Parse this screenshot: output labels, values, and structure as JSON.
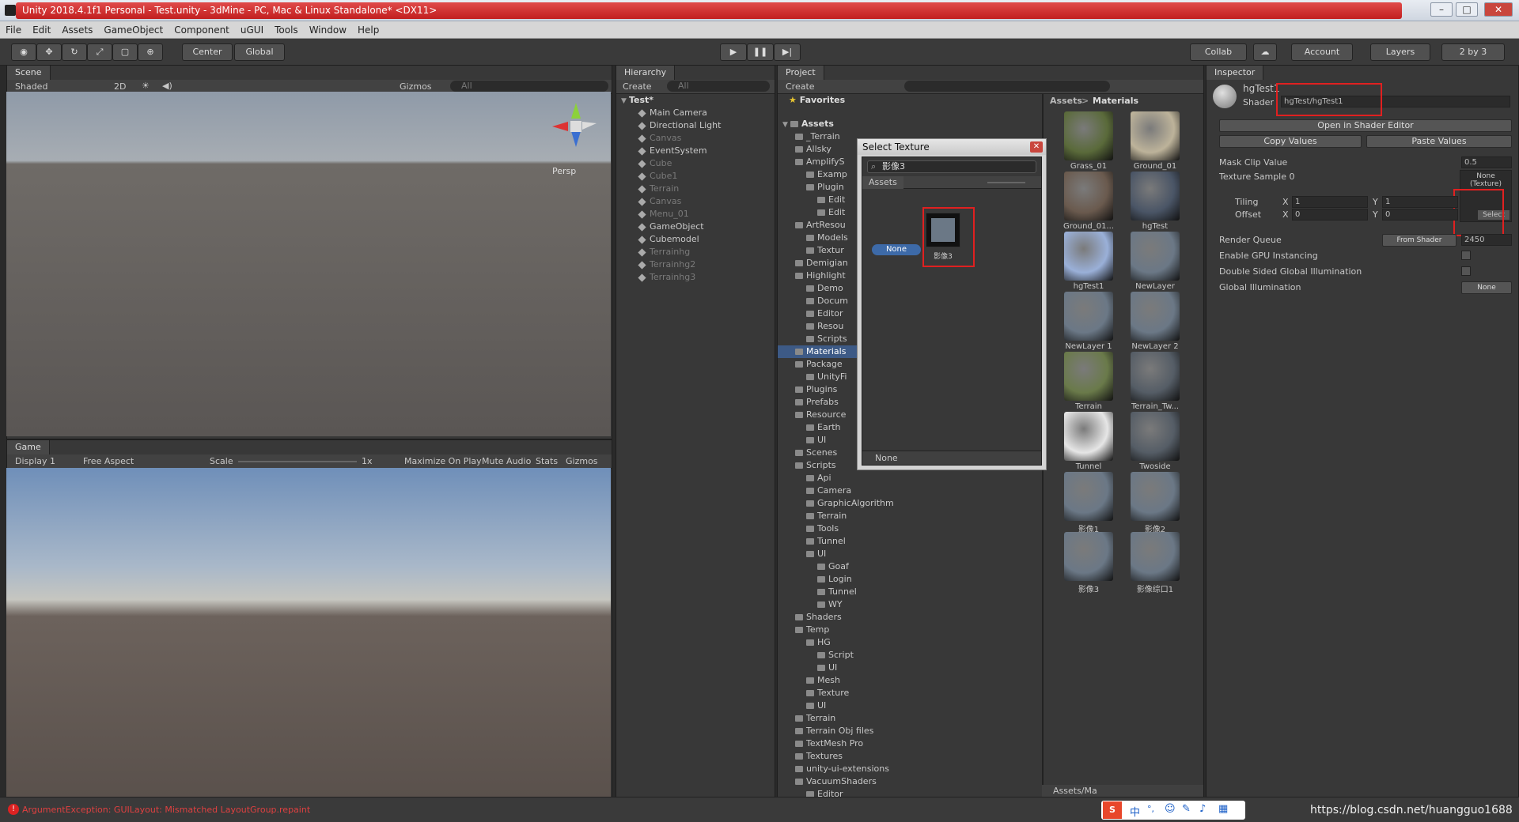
{
  "window": {
    "title": "Unity 2018.4.1f1 Personal - Test.unity - 3dMine - PC, Mac & Linux Standalone* <DX11>"
  },
  "menu": [
    "File",
    "Edit",
    "Assets",
    "GameObject",
    "Component",
    "uGUI",
    "Tools",
    "Window",
    "Help"
  ],
  "toolbar": {
    "center": "Center",
    "global": "Global",
    "collab": "Collab",
    "account": "Account",
    "layers": "Layers",
    "layout": "2 by 3"
  },
  "scene": {
    "tab": "Scene",
    "shading": "Shaded",
    "mode2d": "2D",
    "gizmos": "Gizmos",
    "search": "All",
    "persp": "Persp"
  },
  "game": {
    "tab": "Game",
    "display": "Display 1",
    "aspect": "Free Aspect",
    "scale": "Scale",
    "scale_val": "1x",
    "maximize": "Maximize On Play",
    "mute": "Mute Audio",
    "stats": "Stats",
    "gizmos": "Gizmos"
  },
  "hierarchy": {
    "tab": "Hierarchy",
    "create": "Create",
    "search": "All",
    "scene": "Test*",
    "items": [
      {
        "label": "Main Camera",
        "dim": false
      },
      {
        "label": "Directional Light",
        "dim": false
      },
      {
        "label": "Canvas",
        "dim": true
      },
      {
        "label": "EventSystem",
        "dim": false
      },
      {
        "label": "Cube",
        "dim": true
      },
      {
        "label": "Cube1",
        "dim": true
      },
      {
        "label": "Terrain",
        "dim": true
      },
      {
        "label": "Canvas",
        "dim": true
      },
      {
        "label": "Menu_01",
        "dim": true
      },
      {
        "label": "GameObject",
        "dim": false
      },
      {
        "label": "Cubemodel",
        "dim": false
      },
      {
        "label": "Terrainhg",
        "dim": true
      },
      {
        "label": "Terrainhg2",
        "dim": true
      },
      {
        "label": "Terrainhg3",
        "dim": true
      }
    ]
  },
  "project": {
    "tab": "Project",
    "create": "Create",
    "favorites": "Favorites",
    "assets": "Assets",
    "breadcrumb": [
      "Assets",
      "Materials"
    ],
    "folders": [
      {
        "label": "_Terrain",
        "indent": 1
      },
      {
        "label": "Allsky",
        "indent": 1
      },
      {
        "label": "AmplifyS",
        "indent": 1
      },
      {
        "label": "Examp",
        "indent": 2
      },
      {
        "label": "Plugin",
        "indent": 2
      },
      {
        "label": "Edit",
        "indent": 3
      },
      {
        "label": "Edit",
        "indent": 3
      },
      {
        "label": "ArtResou",
        "indent": 1
      },
      {
        "label": "Models",
        "indent": 2
      },
      {
        "label": "Textur",
        "indent": 2
      },
      {
        "label": "Demigian",
        "indent": 1
      },
      {
        "label": "Highlight",
        "indent": 1
      },
      {
        "label": "Demo",
        "indent": 2
      },
      {
        "label": "Docum",
        "indent": 2
      },
      {
        "label": "Editor",
        "indent": 2
      },
      {
        "label": "Resou",
        "indent": 2
      },
      {
        "label": "Scripts",
        "indent": 2
      },
      {
        "label": "Materials",
        "indent": 1,
        "sel": true
      },
      {
        "label": "Package",
        "indent": 1
      },
      {
        "label": "UnityFi",
        "indent": 2
      },
      {
        "label": "Plugins",
        "indent": 1
      },
      {
        "label": "Prefabs",
        "indent": 1
      },
      {
        "label": "Resource",
        "indent": 1
      },
      {
        "label": "Earth",
        "indent": 2
      },
      {
        "label": "UI",
        "indent": 2
      },
      {
        "label": "Scenes",
        "indent": 1
      },
      {
        "label": "Scripts",
        "indent": 1
      },
      {
        "label": "Api",
        "indent": 2
      },
      {
        "label": "Camera",
        "indent": 2
      },
      {
        "label": "GraphicAlgorithm",
        "indent": 2
      },
      {
        "label": "Terrain",
        "indent": 2
      },
      {
        "label": "Tools",
        "indent": 2
      },
      {
        "label": "Tunnel",
        "indent": 2
      },
      {
        "label": "UI",
        "indent": 2
      },
      {
        "label": "Goaf",
        "indent": 3
      },
      {
        "label": "Login",
        "indent": 3
      },
      {
        "label": "Tunnel",
        "indent": 3
      },
      {
        "label": "WY",
        "indent": 3
      },
      {
        "label": "Shaders",
        "indent": 1
      },
      {
        "label": "Temp",
        "indent": 1
      },
      {
        "label": "HG",
        "indent": 2
      },
      {
        "label": "Script",
        "indent": 3
      },
      {
        "label": "UI",
        "indent": 3
      },
      {
        "label": "Mesh",
        "indent": 2
      },
      {
        "label": "Texture",
        "indent": 2
      },
      {
        "label": "UI",
        "indent": 2
      },
      {
        "label": "Terrain",
        "indent": 1
      },
      {
        "label": "Terrain Obj files",
        "indent": 1
      },
      {
        "label": "TextMesh Pro",
        "indent": 1
      },
      {
        "label": "Textures",
        "indent": 1
      },
      {
        "label": "unity-ui-extensions",
        "indent": 1
      },
      {
        "label": "VacuumShaders",
        "indent": 1
      },
      {
        "label": "Editor",
        "indent": 2
      }
    ],
    "assets_grid": [
      {
        "label": "Grass_01",
        "color": "#5a6a3a"
      },
      {
        "label": "Ground_01",
        "color": "#bdb39a"
      },
      {
        "label": "Ground_01...",
        "color": "#6a5a4e"
      },
      {
        "label": "hgTest",
        "color": "#4a5566"
      },
      {
        "label": "hgTest1",
        "color": "#9ab0d8"
      },
      {
        "label": "NewLayer",
        "color": "#6b7886"
      },
      {
        "label": "NewLayer 1",
        "color": "#6b7886"
      },
      {
        "label": "NewLayer 2",
        "color": "#6b7886"
      },
      {
        "label": "Terrain",
        "color": "#6a7a4a"
      },
      {
        "label": "Terrain_Tw...",
        "color": "#555d66"
      },
      {
        "label": "Tunnel",
        "color": "#e6e6e6"
      },
      {
        "label": "Twoside",
        "color": "#555d66"
      },
      {
        "label": "影像1",
        "color": "#6b7886"
      },
      {
        "label": "影像2",
        "color": "#6b7886"
      },
      {
        "label": "影像3",
        "color": "#6b7886"
      },
      {
        "label": "影像综口1",
        "color": "#6b7886"
      }
    ],
    "footer": "Assets/Ma"
  },
  "dialog": {
    "title": "Select Texture",
    "search": "影像3",
    "tab": "Assets",
    "none": "None",
    "item": "影像3",
    "footer": "None"
  },
  "inspector": {
    "tab": "Inspector",
    "name": "hgTest1",
    "shader_label": "Shader",
    "shader": "hgTest/hgTest1",
    "open_editor": "Open in Shader Editor",
    "copy": "Copy Values",
    "paste": "Paste Values",
    "mask_clip_label": "Mask Clip Value",
    "mask_clip": "0.5",
    "tex_label": "Texture Sample 0",
    "tex_value": "None (Texture)",
    "select": "Select",
    "tiling": "Tiling",
    "offset": "Offset",
    "tx": "1",
    "ty": "1",
    "ox": "0",
    "oy": "0",
    "render_queue": "Render Queue",
    "render_from": "From Shader",
    "render_val": "2450",
    "gpu": "Enable GPU Instancing",
    "double": "Double Sided Global Illumination",
    "gi": "Global Illumination",
    "gi_val": "None"
  },
  "status": {
    "error": "ArgumentException: GUILayout: Mismatched LayoutGroup.repaint",
    "url": "https://blog.csdn.net/huangguo1688"
  },
  "tray": [
    "中",
    "°,",
    "☺",
    "✎",
    "♪",
    "▦"
  ]
}
